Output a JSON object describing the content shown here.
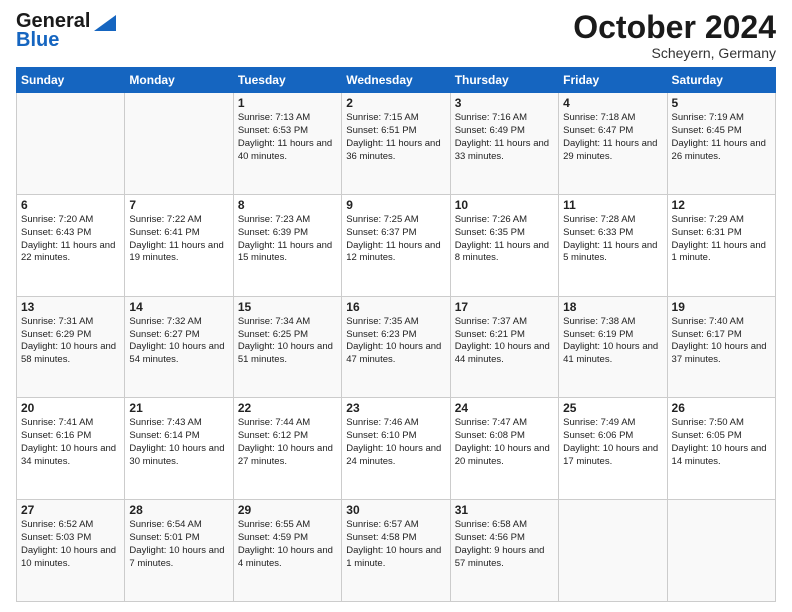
{
  "header": {
    "logo_general": "General",
    "logo_blue": "Blue",
    "month": "October 2024",
    "location": "Scheyern, Germany"
  },
  "weekdays": [
    "Sunday",
    "Monday",
    "Tuesday",
    "Wednesday",
    "Thursday",
    "Friday",
    "Saturday"
  ],
  "weeks": [
    [
      {
        "day": "",
        "info": ""
      },
      {
        "day": "",
        "info": ""
      },
      {
        "day": "1",
        "info": "Sunrise: 7:13 AM\nSunset: 6:53 PM\nDaylight: 11 hours and 40 minutes."
      },
      {
        "day": "2",
        "info": "Sunrise: 7:15 AM\nSunset: 6:51 PM\nDaylight: 11 hours and 36 minutes."
      },
      {
        "day": "3",
        "info": "Sunrise: 7:16 AM\nSunset: 6:49 PM\nDaylight: 11 hours and 33 minutes."
      },
      {
        "day": "4",
        "info": "Sunrise: 7:18 AM\nSunset: 6:47 PM\nDaylight: 11 hours and 29 minutes."
      },
      {
        "day": "5",
        "info": "Sunrise: 7:19 AM\nSunset: 6:45 PM\nDaylight: 11 hours and 26 minutes."
      }
    ],
    [
      {
        "day": "6",
        "info": "Sunrise: 7:20 AM\nSunset: 6:43 PM\nDaylight: 11 hours and 22 minutes."
      },
      {
        "day": "7",
        "info": "Sunrise: 7:22 AM\nSunset: 6:41 PM\nDaylight: 11 hours and 19 minutes."
      },
      {
        "day": "8",
        "info": "Sunrise: 7:23 AM\nSunset: 6:39 PM\nDaylight: 11 hours and 15 minutes."
      },
      {
        "day": "9",
        "info": "Sunrise: 7:25 AM\nSunset: 6:37 PM\nDaylight: 11 hours and 12 minutes."
      },
      {
        "day": "10",
        "info": "Sunrise: 7:26 AM\nSunset: 6:35 PM\nDaylight: 11 hours and 8 minutes."
      },
      {
        "day": "11",
        "info": "Sunrise: 7:28 AM\nSunset: 6:33 PM\nDaylight: 11 hours and 5 minutes."
      },
      {
        "day": "12",
        "info": "Sunrise: 7:29 AM\nSunset: 6:31 PM\nDaylight: 11 hours and 1 minute."
      }
    ],
    [
      {
        "day": "13",
        "info": "Sunrise: 7:31 AM\nSunset: 6:29 PM\nDaylight: 10 hours and 58 minutes."
      },
      {
        "day": "14",
        "info": "Sunrise: 7:32 AM\nSunset: 6:27 PM\nDaylight: 10 hours and 54 minutes."
      },
      {
        "day": "15",
        "info": "Sunrise: 7:34 AM\nSunset: 6:25 PM\nDaylight: 10 hours and 51 minutes."
      },
      {
        "day": "16",
        "info": "Sunrise: 7:35 AM\nSunset: 6:23 PM\nDaylight: 10 hours and 47 minutes."
      },
      {
        "day": "17",
        "info": "Sunrise: 7:37 AM\nSunset: 6:21 PM\nDaylight: 10 hours and 44 minutes."
      },
      {
        "day": "18",
        "info": "Sunrise: 7:38 AM\nSunset: 6:19 PM\nDaylight: 10 hours and 41 minutes."
      },
      {
        "day": "19",
        "info": "Sunrise: 7:40 AM\nSunset: 6:17 PM\nDaylight: 10 hours and 37 minutes."
      }
    ],
    [
      {
        "day": "20",
        "info": "Sunrise: 7:41 AM\nSunset: 6:16 PM\nDaylight: 10 hours and 34 minutes."
      },
      {
        "day": "21",
        "info": "Sunrise: 7:43 AM\nSunset: 6:14 PM\nDaylight: 10 hours and 30 minutes."
      },
      {
        "day": "22",
        "info": "Sunrise: 7:44 AM\nSunset: 6:12 PM\nDaylight: 10 hours and 27 minutes."
      },
      {
        "day": "23",
        "info": "Sunrise: 7:46 AM\nSunset: 6:10 PM\nDaylight: 10 hours and 24 minutes."
      },
      {
        "day": "24",
        "info": "Sunrise: 7:47 AM\nSunset: 6:08 PM\nDaylight: 10 hours and 20 minutes."
      },
      {
        "day": "25",
        "info": "Sunrise: 7:49 AM\nSunset: 6:06 PM\nDaylight: 10 hours and 17 minutes."
      },
      {
        "day": "26",
        "info": "Sunrise: 7:50 AM\nSunset: 6:05 PM\nDaylight: 10 hours and 14 minutes."
      }
    ],
    [
      {
        "day": "27",
        "info": "Sunrise: 6:52 AM\nSunset: 5:03 PM\nDaylight: 10 hours and 10 minutes."
      },
      {
        "day": "28",
        "info": "Sunrise: 6:54 AM\nSunset: 5:01 PM\nDaylight: 10 hours and 7 minutes."
      },
      {
        "day": "29",
        "info": "Sunrise: 6:55 AM\nSunset: 4:59 PM\nDaylight: 10 hours and 4 minutes."
      },
      {
        "day": "30",
        "info": "Sunrise: 6:57 AM\nSunset: 4:58 PM\nDaylight: 10 hours and 1 minute."
      },
      {
        "day": "31",
        "info": "Sunrise: 6:58 AM\nSunset: 4:56 PM\nDaylight: 9 hours and 57 minutes."
      },
      {
        "day": "",
        "info": ""
      },
      {
        "day": "",
        "info": ""
      }
    ]
  ]
}
